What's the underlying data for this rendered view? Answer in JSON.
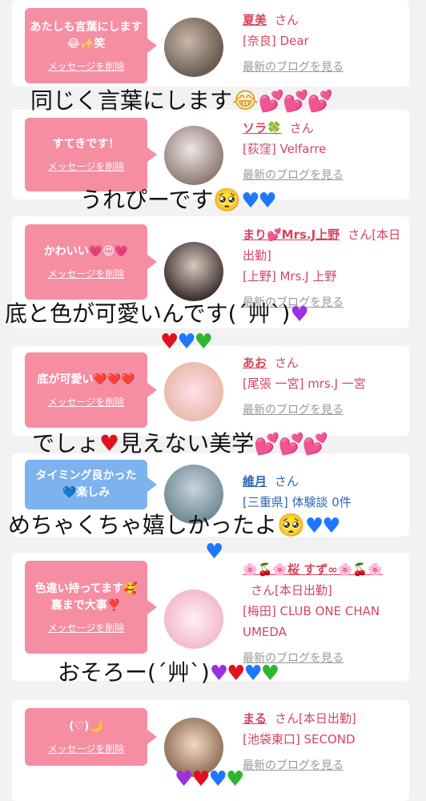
{
  "cards": [
    {
      "message": "あたしも言葉にします😂✨笑",
      "delete": "メッセージを削除",
      "name": "夏美",
      "san": "さん",
      "shop": "[奈良] Dear",
      "blog": "最新のブログを見る",
      "color": "pink"
    },
    {
      "message": "すてきです！",
      "delete": "メッセージを削除",
      "name": "ソラ🍀",
      "san": "さん",
      "shop": "[荻窪] Velfarre",
      "blog": "最新のブログを見る",
      "color": "pink"
    },
    {
      "message": "かわいい💗😍💗",
      "delete": "メッセージを削除",
      "name": "まり💕Mrs.J上野",
      "san": "さん[本日出勤]",
      "shop": "[上野] Mrs.J 上野",
      "blog": "最新のブログを見る",
      "color": "pink"
    },
    {
      "message": "底が可愛い❤️❤️❤️",
      "delete": "メッセージを削除",
      "name": "あお",
      "san": "さん",
      "shop": "[尾張 一宮] mrs.J 一宮",
      "blog": "最新のブログを見る",
      "color": "pink"
    },
    {
      "message": "タイミング良かった💙楽しみ",
      "delete": "メッセージを削除",
      "name": "維月",
      "san": "さん",
      "shop": "[三重県] 体験談 0件",
      "blog": "",
      "color": "blue"
    },
    {
      "message": "色違い持ってます🥰裏まで大事❣️",
      "delete": "メッセージを削除",
      "name": "🌸🍒🌸桜 すず∞🌸🍒🌸",
      "san": "さん[本日出勤]",
      "shop": "[梅田] CLUB ONE CHAN UMEDA",
      "blog": "最新のブログを見る",
      "color": "pink"
    },
    {
      "message": "(♡)🌙",
      "delete": "メッセージを削除",
      "name": "まる",
      "san": "さん[本日出勤]",
      "shop": "[池袋東口] SECOND",
      "blog": "最新のブログを見る",
      "color": "pink"
    }
  ],
  "overlays": {
    "o1": "同じく言葉にします",
    "o2": "うれぴーです",
    "o3": "底と色が可愛いんです(´艸`)",
    "o4": "でしょ",
    "o4b": "見えない美学",
    "o5": "めちゃくちゃ嬉しかったよ",
    "o6": "おそろー(´艸`)"
  }
}
